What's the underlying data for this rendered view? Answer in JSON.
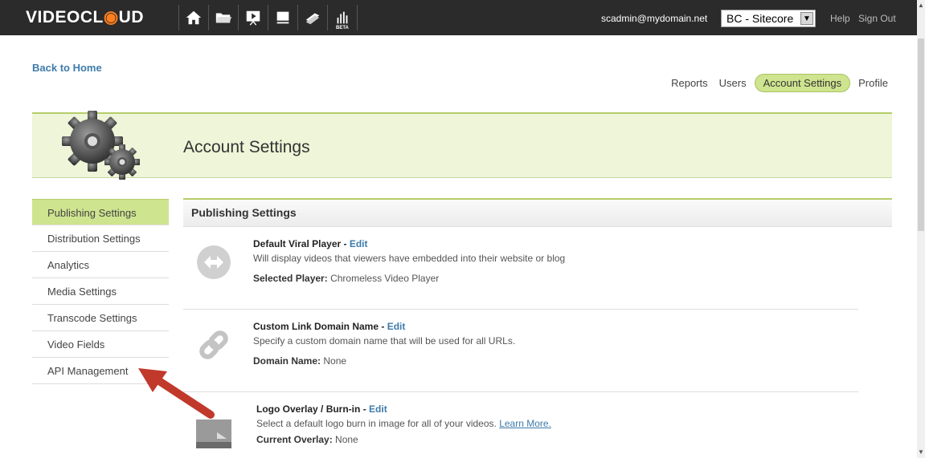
{
  "logo": {
    "part1": "VIDEOCL",
    "part2": "UD"
  },
  "nav_icons": [
    "home-icon",
    "folder-icon",
    "player-icon",
    "media-icon",
    "publish-icon",
    "analytics-beta-icon"
  ],
  "beta_label": "BETA",
  "user_email": "scadmin@mydomain.net",
  "account_selector": {
    "value": "BC - Sitecore"
  },
  "help_label": "Help",
  "signout_label": "Sign Out",
  "back_home": "Back to Home",
  "subnav": {
    "reports": "Reports",
    "users": "Users",
    "account_settings": "Account Settings",
    "profile": "Profile"
  },
  "page_title": "Account Settings",
  "sidebar": {
    "items": [
      {
        "label": "Publishing Settings"
      },
      {
        "label": "Distribution Settings"
      },
      {
        "label": "Analytics"
      },
      {
        "label": "Media Settings"
      },
      {
        "label": "Transcode Settings"
      },
      {
        "label": "Video Fields"
      },
      {
        "label": "API Management"
      }
    ]
  },
  "panel_title": "Publishing Settings",
  "settings": [
    {
      "title": "Default Viral Player",
      "edit": "Edit",
      "desc": "Will display videos that viewers have embedded into their website or blog",
      "value_label": "Selected Player:",
      "value": "Chromeless Video Player"
    },
    {
      "title": "Custom Link Domain Name",
      "edit": "Edit",
      "desc": "Specify a custom domain name that will be used for all URLs.",
      "value_label": "Domain Name:",
      "value": "None"
    },
    {
      "title": "Logo Overlay / Burn-in",
      "edit": "Edit",
      "desc": "Select a default logo burn in image for all of your videos.",
      "learn_more": "Learn More.",
      "value_label": "Current Overlay:",
      "value": "None"
    }
  ],
  "colors": {
    "accent_green": "#cfe48f",
    "link_blue": "#3d7bab",
    "topbar": "#2b2b2b",
    "logo_orange": "#ff7f1f",
    "annotation_arrow": "#c0392b"
  }
}
